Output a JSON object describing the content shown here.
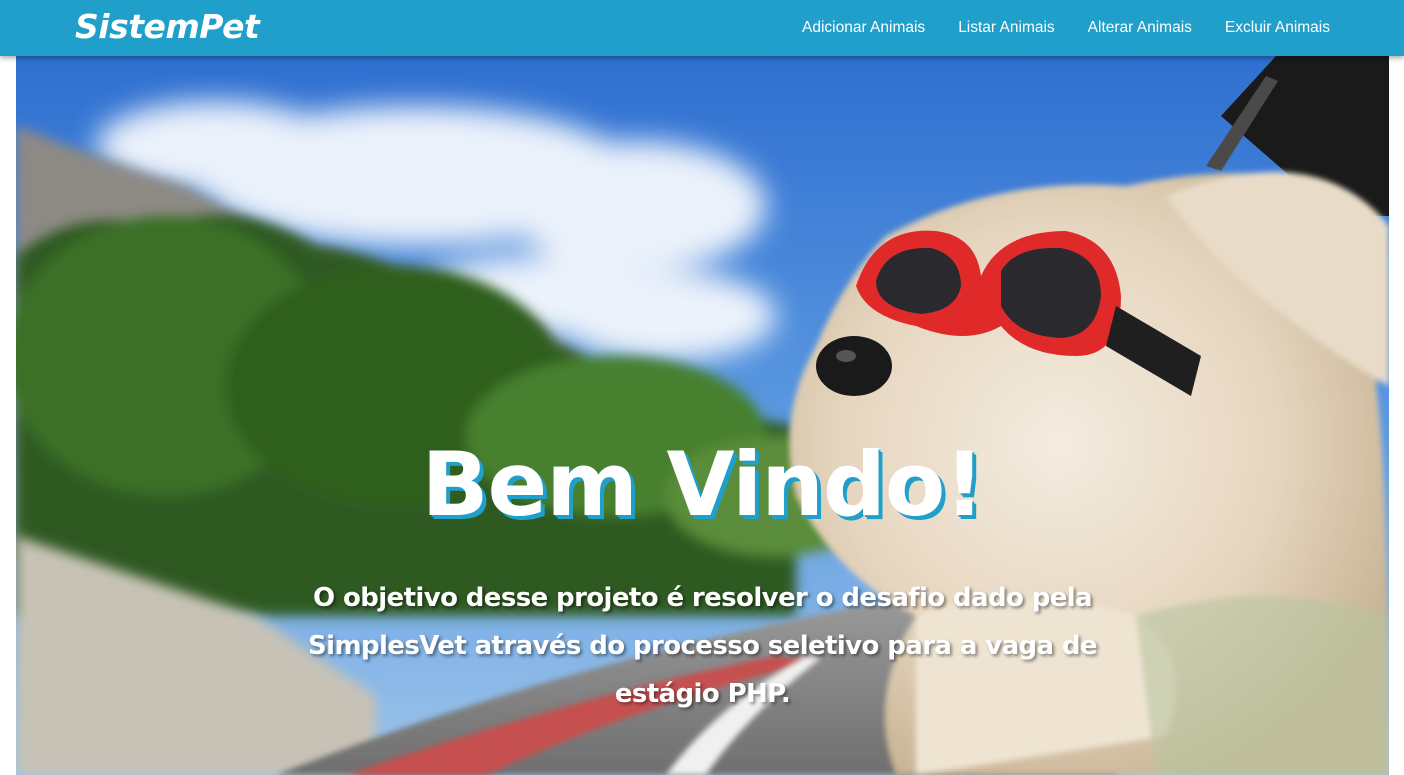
{
  "navbar": {
    "brand": "SistemPet",
    "links": [
      "Adicionar Animais",
      "Listar Animais",
      "Alterar Animais",
      "Excluir Animais"
    ],
    "background": "#1f9fc9"
  },
  "hero": {
    "title": "Bem Vindo!",
    "text": "O objetivo desse projeto é resolver o desafio dado pela SimplesVet através do processo seletivo para a vaga de estágio PHP.",
    "image": "dog-with-red-goggles-in-car-window"
  }
}
